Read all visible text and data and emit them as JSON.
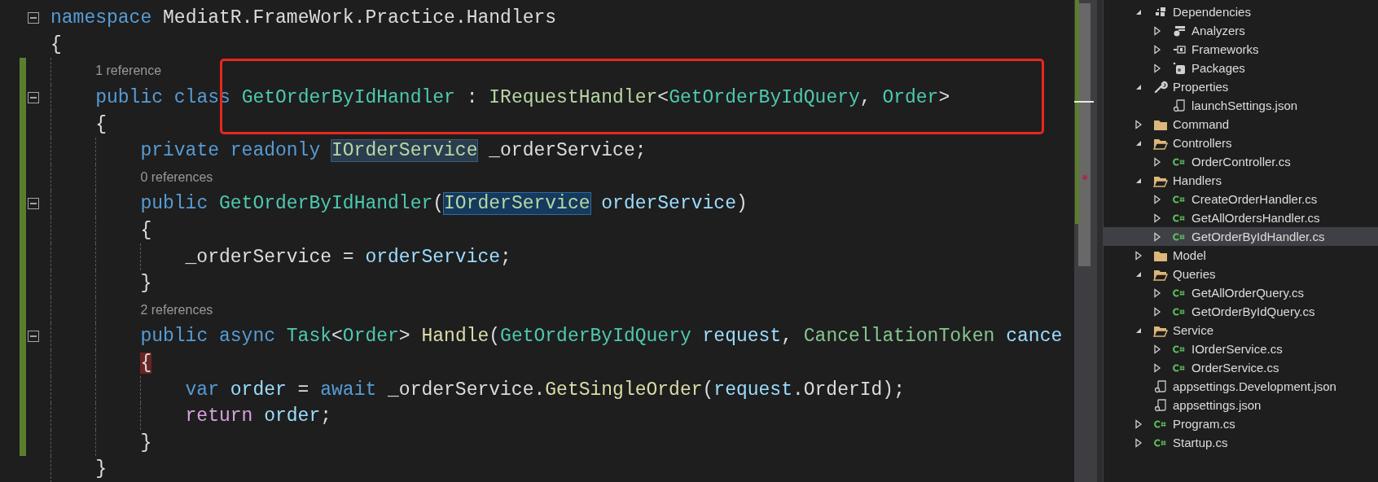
{
  "editor": {
    "lines": [
      {
        "kind": "code",
        "fold": true,
        "changed": false,
        "tokens": [
          {
            "text": "namespace ",
            "kind": "keyword"
          },
          {
            "text": "MediatR.FrameWork.Practice.Handlers",
            "kind": "plain"
          }
        ]
      },
      {
        "kind": "code",
        "fold": false,
        "changed": false,
        "tokens": [
          {
            "text": "{",
            "kind": "plain"
          }
        ]
      },
      {
        "kind": "codelens",
        "fold": false,
        "changed": true,
        "tokens": [
          {
            "text": "    1 reference",
            "kind": "plain"
          }
        ]
      },
      {
        "kind": "code",
        "fold": true,
        "changed": true,
        "tokens": [
          {
            "text": "    public class ",
            "kind": "keyword"
          },
          {
            "text": "GetOrderByIdHandler",
            "kind": "type"
          },
          {
            "text": " : ",
            "kind": "plain"
          },
          {
            "text": "IRequestHandler",
            "kind": "interface"
          },
          {
            "text": "<",
            "kind": "plain"
          },
          {
            "text": "GetOrderByIdQuery",
            "kind": "type"
          },
          {
            "text": ", ",
            "kind": "plain"
          },
          {
            "text": "Order",
            "kind": "type"
          },
          {
            "text": ">",
            "kind": "plain"
          }
        ]
      },
      {
        "kind": "code",
        "fold": false,
        "changed": true,
        "tokens": [
          {
            "text": "    {",
            "kind": "plain"
          }
        ]
      },
      {
        "kind": "code",
        "fold": false,
        "changed": true,
        "tokens": [
          {
            "text": "        private readonly ",
            "kind": "keyword"
          },
          {
            "text": "IOrderService",
            "kind": "interface-ref"
          },
          {
            "text": " _orderService;",
            "kind": "plain"
          }
        ]
      },
      {
        "kind": "codelens",
        "fold": false,
        "changed": true,
        "tokens": [
          {
            "text": "        0 references",
            "kind": "plain"
          }
        ]
      },
      {
        "kind": "code",
        "fold": true,
        "changed": true,
        "tokens": [
          {
            "text": "        public ",
            "kind": "keyword"
          },
          {
            "text": "GetOrderByIdHandler",
            "kind": "type"
          },
          {
            "text": "(",
            "kind": "plain"
          },
          {
            "text": "IOrderService",
            "kind": "interface-sel"
          },
          {
            "text": " orderService",
            "kind": "param"
          },
          {
            "text": ")",
            "kind": "plain"
          }
        ]
      },
      {
        "kind": "code",
        "fold": false,
        "changed": true,
        "tokens": [
          {
            "text": "        {",
            "kind": "plain"
          }
        ]
      },
      {
        "kind": "code",
        "fold": false,
        "changed": true,
        "tokens": [
          {
            "text": "            _orderService = ",
            "kind": "plain"
          },
          {
            "text": "orderService",
            "kind": "param"
          },
          {
            "text": ";",
            "kind": "plain"
          }
        ]
      },
      {
        "kind": "code",
        "fold": false,
        "changed": true,
        "tokens": [
          {
            "text": "        }",
            "kind": "plain"
          }
        ]
      },
      {
        "kind": "codelens",
        "fold": false,
        "changed": true,
        "tokens": [
          {
            "text": "        2 references",
            "kind": "plain"
          }
        ]
      },
      {
        "kind": "code",
        "fold": true,
        "changed": true,
        "tokens": [
          {
            "text": "        public async ",
            "kind": "keyword"
          },
          {
            "text": "Task",
            "kind": "type"
          },
          {
            "text": "<",
            "kind": "plain"
          },
          {
            "text": "Order",
            "kind": "type"
          },
          {
            "text": "> ",
            "kind": "plain"
          },
          {
            "text": "Handle",
            "kind": "method"
          },
          {
            "text": "(",
            "kind": "plain"
          },
          {
            "text": "GetOrderByIdQuery",
            "kind": "type"
          },
          {
            "text": " request",
            "kind": "param"
          },
          {
            "text": ", ",
            "kind": "plain"
          },
          {
            "text": "CancellationToken",
            "kind": "struct"
          },
          {
            "text": " cance",
            "kind": "param"
          }
        ]
      },
      {
        "kind": "code",
        "fold": false,
        "changed": true,
        "tokens": [
          {
            "text": "        {",
            "kind": "brace-match"
          }
        ]
      },
      {
        "kind": "code",
        "fold": false,
        "changed": true,
        "tokens": [
          {
            "text": "            var ",
            "kind": "keyword"
          },
          {
            "text": "order",
            "kind": "param"
          },
          {
            "text": " = ",
            "kind": "plain"
          },
          {
            "text": "await ",
            "kind": "keyword"
          },
          {
            "text": "_orderService.",
            "kind": "plain"
          },
          {
            "text": "GetSingleOrder",
            "kind": "method"
          },
          {
            "text": "(",
            "kind": "plain"
          },
          {
            "text": "request",
            "kind": "param"
          },
          {
            "text": ".OrderId);",
            "kind": "plain"
          }
        ]
      },
      {
        "kind": "code",
        "fold": false,
        "changed": true,
        "tokens": [
          {
            "text": "            return ",
            "kind": "control"
          },
          {
            "text": "order",
            "kind": "param"
          },
          {
            "text": ";",
            "kind": "plain"
          }
        ]
      },
      {
        "kind": "code",
        "fold": false,
        "changed": true,
        "tokens": [
          {
            "text": "        }",
            "kind": "plain"
          }
        ]
      },
      {
        "kind": "code",
        "fold": false,
        "changed": false,
        "tokens": [
          {
            "text": "    }",
            "kind": "plain"
          }
        ]
      }
    ]
  },
  "solution_explorer": {
    "items": [
      {
        "label": "Dependencies",
        "kind": "dependencies",
        "expanded": true,
        "selected": false,
        "children": [
          {
            "label": "Analyzers",
            "kind": "analyzers",
            "expanded": false,
            "selected": false
          },
          {
            "label": "Frameworks",
            "kind": "frameworks",
            "expanded": false,
            "selected": false
          },
          {
            "label": "Packages",
            "kind": "packages",
            "expanded": false,
            "selected": false
          }
        ]
      },
      {
        "label": "Properties",
        "kind": "properties",
        "expanded": true,
        "selected": false,
        "children": [
          {
            "label": "launchSettings.json",
            "kind": "json",
            "selected": false
          }
        ]
      },
      {
        "label": "Command",
        "kind": "folder",
        "expanded": false,
        "selected": false
      },
      {
        "label": "Controllers",
        "kind": "folder",
        "expanded": true,
        "selected": false,
        "children": [
          {
            "label": "OrderController.cs",
            "kind": "csharp",
            "expanded": false,
            "selected": false
          }
        ]
      },
      {
        "label": "Handlers",
        "kind": "folder",
        "expanded": true,
        "selected": false,
        "children": [
          {
            "label": "CreateOrderHandler.cs",
            "kind": "csharp",
            "expanded": false,
            "selected": false
          },
          {
            "label": "GetAllOrdersHandler.cs",
            "kind": "csharp",
            "expanded": false,
            "selected": false
          },
          {
            "label": "GetOrderByIdHandler.cs",
            "kind": "csharp",
            "expanded": false,
            "selected": true
          }
        ]
      },
      {
        "label": "Model",
        "kind": "folder",
        "expanded": false,
        "selected": false
      },
      {
        "label": "Queries",
        "kind": "folder",
        "expanded": true,
        "selected": false,
        "children": [
          {
            "label": "GetAllOrderQuery.cs",
            "kind": "csharp",
            "expanded": false,
            "selected": false
          },
          {
            "label": "GetOrderByIdQuery.cs",
            "kind": "csharp",
            "expanded": false,
            "selected": false
          }
        ]
      },
      {
        "label": "Service",
        "kind": "folder",
        "expanded": true,
        "selected": false,
        "children": [
          {
            "label": "IOrderService.cs",
            "kind": "csharp",
            "expanded": false,
            "selected": false
          },
          {
            "label": "OrderService.cs",
            "kind": "csharp",
            "expanded": false,
            "selected": false
          }
        ]
      },
      {
        "label": "appsettings.Development.json",
        "kind": "json",
        "selected": false
      },
      {
        "label": "appsettings.json",
        "kind": "json",
        "selected": false
      },
      {
        "label": "Program.cs",
        "kind": "csharp",
        "expanded": false,
        "selected": false
      },
      {
        "label": "Startup.cs",
        "kind": "csharp",
        "expanded": false,
        "selected": false
      }
    ]
  }
}
